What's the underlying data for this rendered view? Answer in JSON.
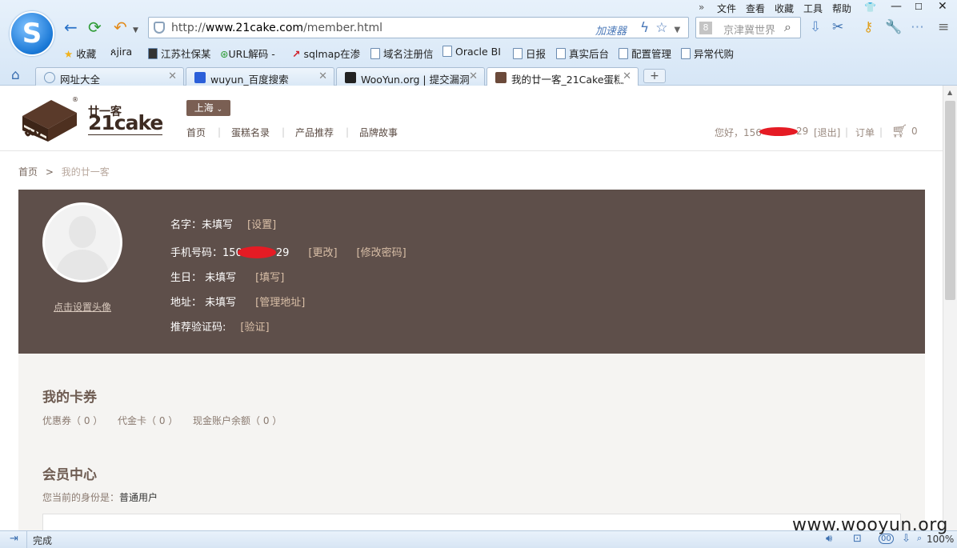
{
  "browser": {
    "menu": [
      "文件",
      "查看",
      "收藏",
      "工具",
      "帮助"
    ],
    "url_prefix": "http://",
    "url_domain": "www.21cake.com",
    "url_path": "/member.html",
    "accel_label": "加速器",
    "search_placeholder": "京津冀世界",
    "search_engine_glyph": "8",
    "favorites": [
      "收藏",
      "jira",
      "江苏社保某",
      "URL解码 -",
      "sqlmap在渗",
      "域名注册信",
      "Oracle BI",
      "日报",
      "真实后台",
      "配置管理",
      "异常代购"
    ],
    "tabs": [
      "网址大全",
      "wuyun_百度搜索",
      "WooYun.org | 提交漏洞",
      "我的廿一客_21Cake蛋糕"
    ],
    "status_text": "完成",
    "zoom": "100%",
    "status_badge": "00"
  },
  "site": {
    "brand_cn": "廿一客",
    "brand_en": "21cake",
    "reg_mark": "®",
    "city": "上海",
    "city_arrow": "⌄",
    "nav": [
      "首页",
      "蛋糕名录",
      "产品推荐",
      "品牌故事"
    ],
    "greeting_prefix": "您好，156",
    "greeting_suffix": "29",
    "logout": "[退出]",
    "orders": "订单",
    "cart_count": "0"
  },
  "breadcrumb": {
    "home": "首页",
    "sep": ">",
    "current": "我的廿一客"
  },
  "profile": {
    "set_avatar": "点击设置头像",
    "name_label": "名字：未填写",
    "name_link": "[设置]",
    "phone_label": "手机号码：150",
    "phone_tail": "29",
    "phone_link": "[更改]",
    "password_link": "[修改密码]",
    "birthday_label": "生日：  未填写",
    "birthday_link": "[填写]",
    "address_label": "地址：  未填写",
    "address_link": "[管理地址]",
    "code_label": "推荐验证码:",
    "code_link": "[验证]"
  },
  "cards": {
    "title": "我的卡券",
    "coupon": "优惠券（ 0 ）",
    "voucher": "代金卡（ 0 ）",
    "balance": "现金账户余额（ 0 ）"
  },
  "member": {
    "title": "会员中心",
    "status_prefix": "您当前的身份是：",
    "status_value": "普通用户"
  },
  "watermark": "www.wooyun.org"
}
